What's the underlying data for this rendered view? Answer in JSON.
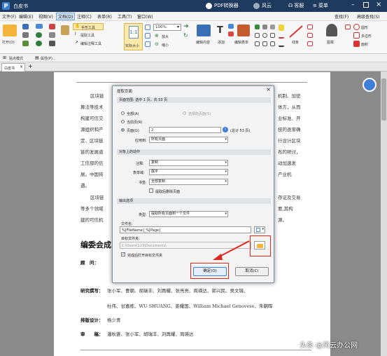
{
  "app": {
    "title": "白皮书",
    "converter": "PDF转换器",
    "user": "风云",
    "service": "客服",
    "menu": "菜单"
  },
  "menu": {
    "items": [
      "文件(F)",
      "编辑(E)",
      "视图(V)",
      "文档(D)",
      "注释(C)",
      "表单(R)",
      "工具(T)",
      "窗口(W)"
    ],
    "active": "文档(D)",
    "right": [
      "查找(F)",
      "高级查找(S)"
    ]
  },
  "ribbon": {
    "open": "打开(O)",
    "hand": "手形工具",
    "extract": "提取工具",
    "edit_note": "编辑注释工具",
    "actual_size": "实际大小",
    "zoom": "100%",
    "zoom_in": "放大",
    "zoom_out": "缩小",
    "edit_content": "编辑内容",
    "add": "添加",
    "edit_form": "编辑表单",
    "line": "线条",
    "stamp": "图章",
    "round": "圆形",
    "polygon": "多边形",
    "area": "面积"
  },
  "bar2": {
    "sticky": "贴点模式",
    "properties": "属性(P)..."
  },
  "tabs": {
    "doc": "白皮书"
  },
  "page_text": {
    "p1": [
      "区块链",
      "算法等技术",
      "构建可信交",
      "源组织和产",
      "定、区块链",
      "链的发展道",
      "工信部的信",
      "展。中国将",
      "遇。"
    ],
    "p1_right": [
      "机制、加密",
      "体方，从而",
      "业标准、开",
      "技的逐渐确",
      "行设计区块",
      "布的研讨，",
      "动加速发",
      "产业机"
    ],
    "p2": [
      "区块链",
      "等多个领域",
      "建的可信机"
    ],
    "p2_right": [
      "存证及交易",
      "要,其构",
      "源。"
    ],
    "heading": "编委会成",
    "advisor": "顾　问：",
    "writers_label": "研究撰写：",
    "writers1": "张小军、曹朝、胡瑞丰、刘再耀、张亮亮、周瑛达、郭兴民、吴文镜、",
    "writers2": "杜伟、甘嘉栋、WU SHUANG、姜耀国、William Michael Genovese、朱朝晖",
    "design_label": "排版设计：",
    "design": "杨少青",
    "review_label": "审　　稿：",
    "review": "潘秋菱、张小军、胡瑞丰、刘再耀、周瑛达"
  },
  "dialog": {
    "title": "提取页面",
    "range_header": "页面范围: 选中 1 页，共 53 页",
    "all": "全部(A)",
    "selected": "选择的页面(S)",
    "current": "当前页(R)",
    "pages": "页面(G)",
    "pages_value": "2",
    "total": "(总计 53 页)",
    "apply_to_label": "应用到:",
    "apply_to": "所有页面",
    "object_header": "对象上的动作",
    "annot_label": "注释:",
    "annot": "复制",
    "form_label": "表单域:",
    "form": "展平",
    "bookmark_label": "书签:",
    "bookmark": "全部复制",
    "delete_after": "提取后删除页面",
    "output_header": "输出选项",
    "type_label": "类型:",
    "type": "提取所有页面到一个文件",
    "filename_label": "文件名:",
    "filename": "%[FileName]_%[Page]",
    "target_label": "目标文件夹:",
    "target": "C:\\Users\\123\\Documents\\",
    "open_after": "完成后打开目标文件夹",
    "ok": "确定(O)",
    "cancel": "取消(C)"
  },
  "watermark": "头条 @风云办公网"
}
